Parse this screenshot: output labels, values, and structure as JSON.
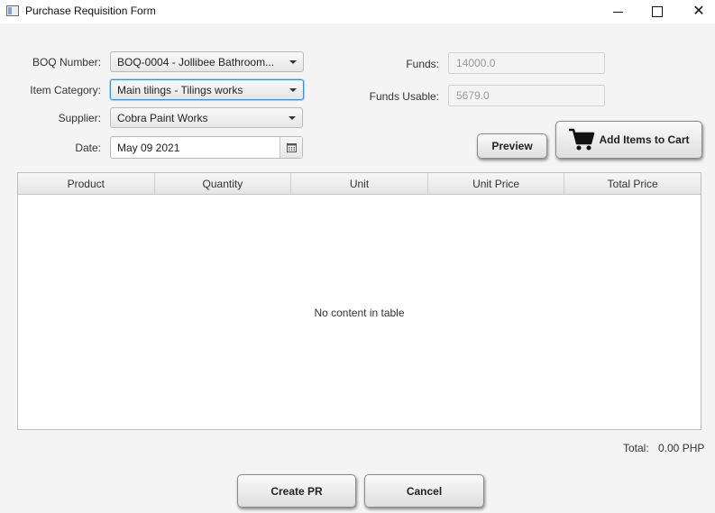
{
  "window": {
    "title": "Purchase Requisition Form"
  },
  "form": {
    "boq_label": "BOQ Number:",
    "boq_value": "BOQ-0004 - Jollibee Bathroom...",
    "category_label": "Item Category:",
    "category_value": "Main tilings - Tilings works",
    "supplier_label": "Supplier:",
    "supplier_value": "Cobra Paint Works",
    "date_label": "Date:",
    "date_value": "May 09 2021",
    "funds_label": "Funds:",
    "funds_value": "14000.0",
    "funds_usable_label": "Funds Usable:",
    "funds_usable_value": "5679.0"
  },
  "buttons": {
    "preview": "Preview",
    "add_to_cart": "Add Items to Cart",
    "create_pr": "Create PR",
    "cancel": "Cancel"
  },
  "table": {
    "columns": [
      "Product",
      "Quantity",
      "Unit",
      "Unit Price",
      "Total Price"
    ],
    "rows": [],
    "empty_text": "No content in table"
  },
  "summary": {
    "total_label": "Total:",
    "total_value": "0.00 PHP"
  },
  "icons": {
    "app": "window-app-icon",
    "cart": "shopping-cart-icon",
    "calendar": "calendar-icon"
  }
}
